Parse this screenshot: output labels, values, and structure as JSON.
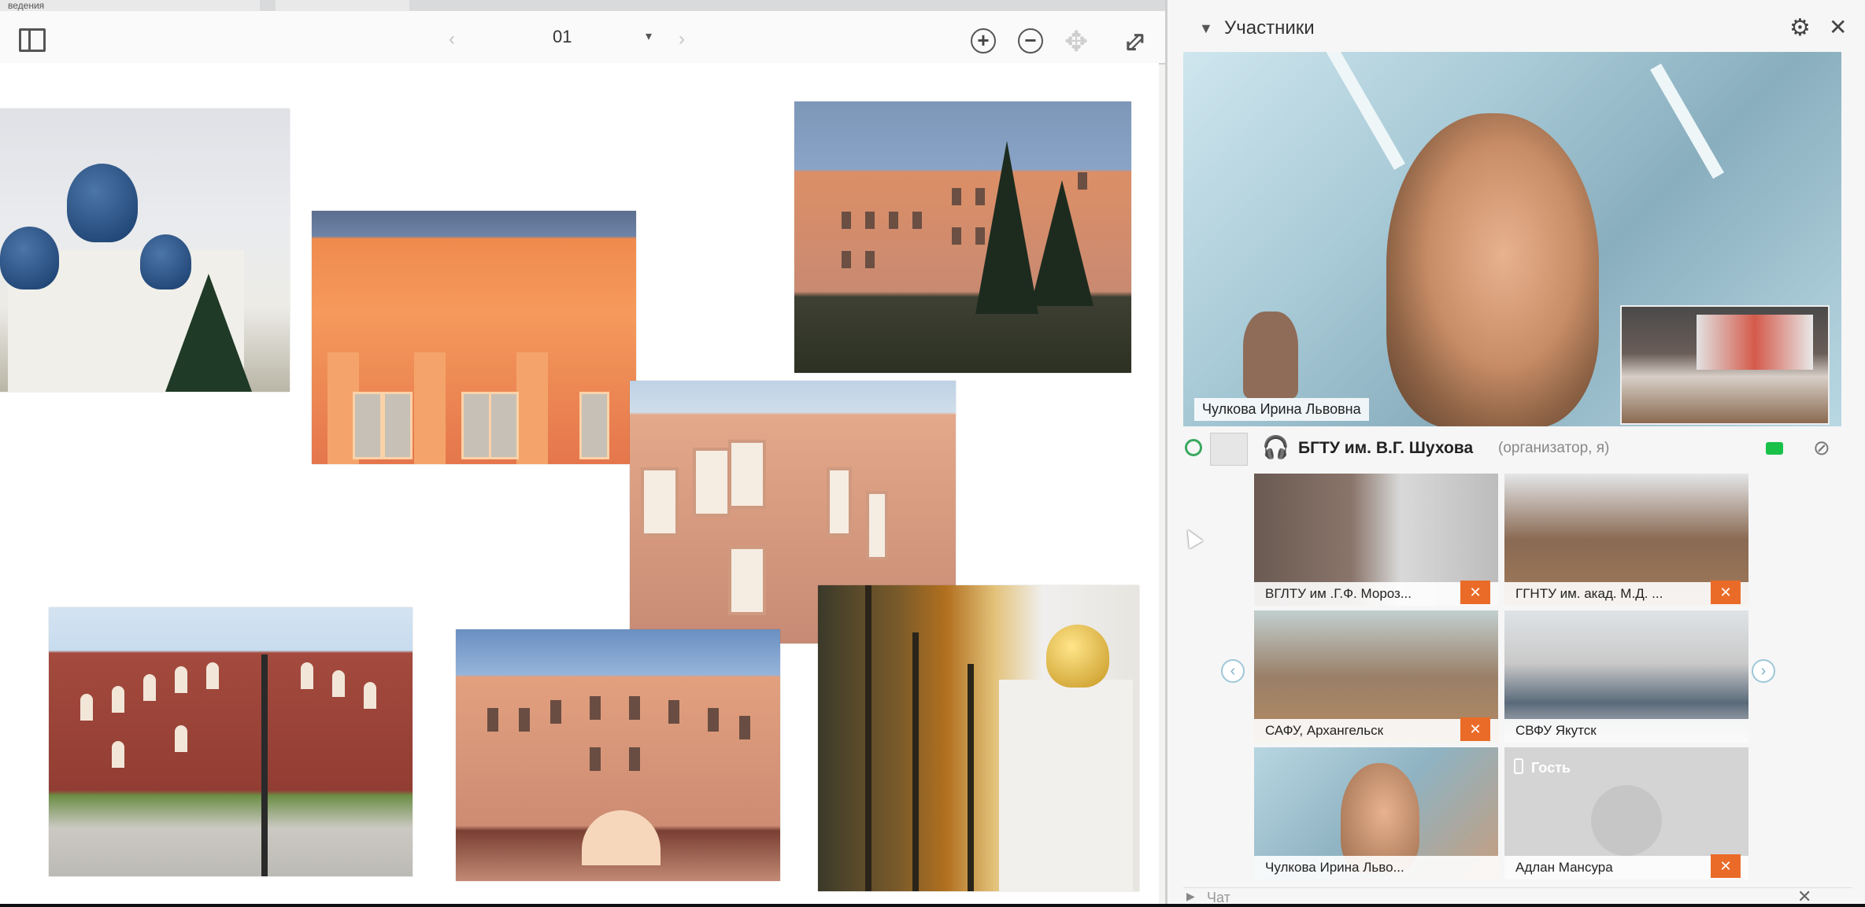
{
  "tabs": [
    {
      "label": "ведения"
    },
    {
      "label": ""
    }
  ],
  "presentation": {
    "page_number": "01",
    "prev_icon": "chevron-left-icon",
    "next_icon": "chevron-right-icon",
    "zoom_in": "+",
    "zoom_out": "−"
  },
  "participants": {
    "title": "Участники",
    "main_speaker_label": "Чулкова Ирина Львовна",
    "organizer_name": "БГТУ им. В.Г. Шухова",
    "organizer_role": "(организатор, я)",
    "tiles": [
      {
        "label": "ВГЛТУ им .Г.Ф. Мороз..."
      },
      {
        "label": "ГГНТУ им. акад. М.Д. ..."
      },
      {
        "label": "САФУ, Архангельск"
      },
      {
        "label": "СВФУ Якутск"
      },
      {
        "label": "Чулкова Ирина Льво..."
      },
      {
        "label": "Адлан Мансура",
        "overlay": "Гость"
      }
    ],
    "grid_prev": "‹",
    "grid_next": "›"
  },
  "chat": {
    "label": "Чат"
  },
  "colors": {
    "accent_green": "#19c149",
    "mute_orange": "#ea6b28",
    "status_green": "#3aa860"
  }
}
